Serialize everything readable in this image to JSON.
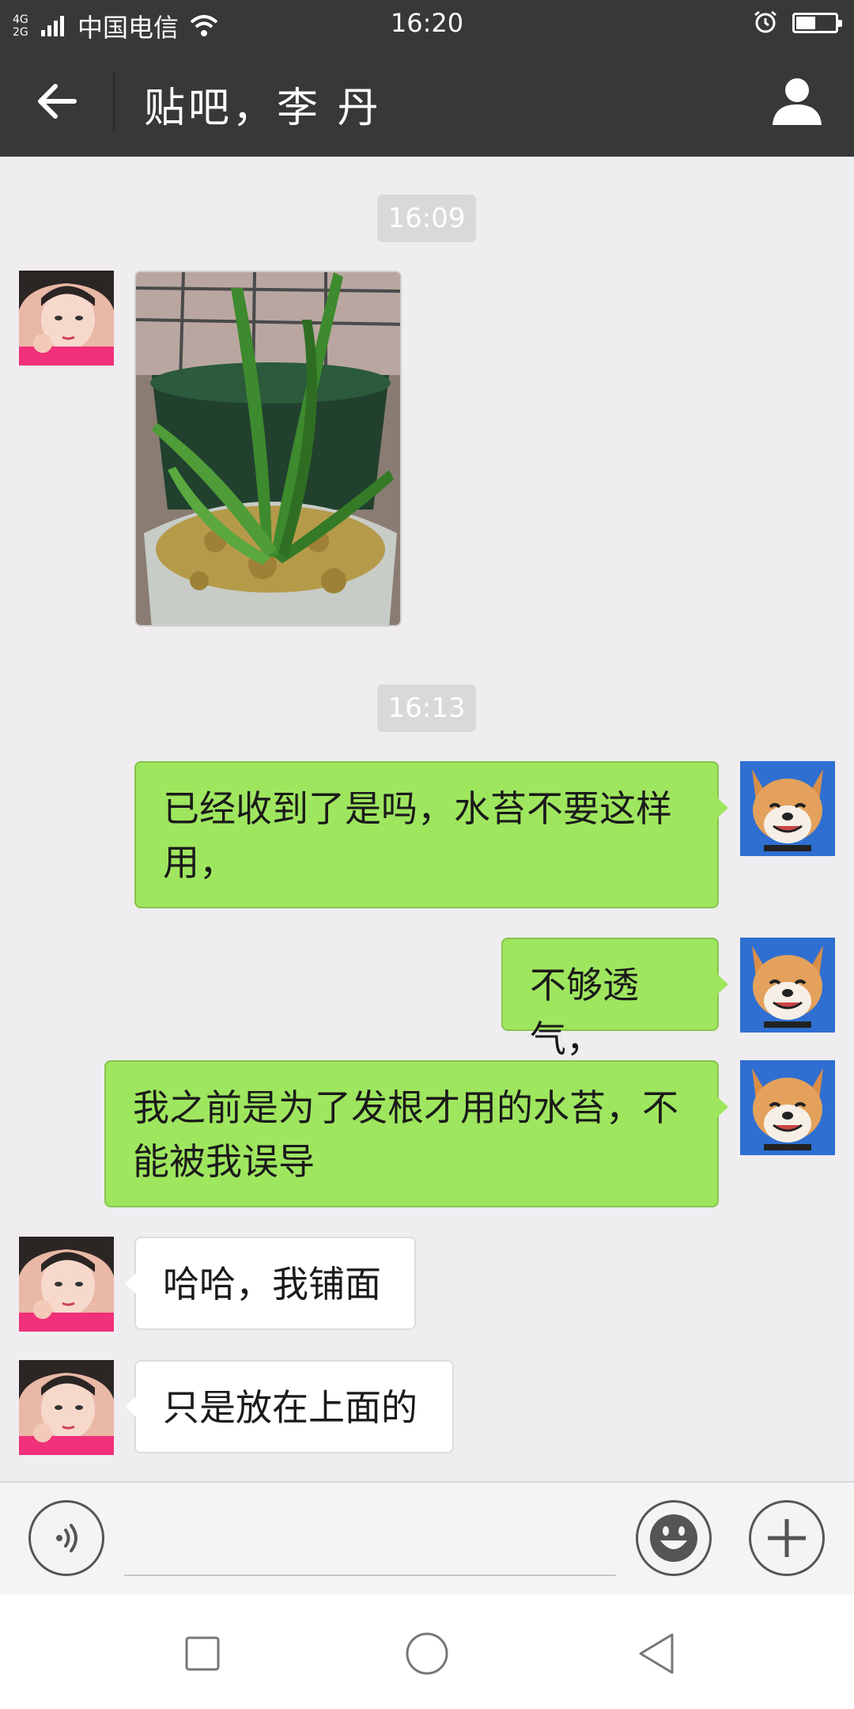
{
  "status_bar": {
    "network": "4G 2G",
    "carrier": "中国电信",
    "time": "16:20"
  },
  "header": {
    "title": "贴吧，李 丹"
  },
  "timestamps": [
    "16:09",
    "16:13"
  ],
  "messages": [
    {
      "sender": "contact",
      "type": "image"
    },
    {
      "sender": "me",
      "type": "text",
      "text": "已经收到了是吗，水苔不要这样用，"
    },
    {
      "sender": "me",
      "type": "text",
      "text": "不够透气，"
    },
    {
      "sender": "me",
      "type": "text",
      "text": "我之前是为了发根才用的水苔，不能被我误导"
    },
    {
      "sender": "contact",
      "type": "text",
      "text": "哈哈，我铺面"
    },
    {
      "sender": "contact",
      "type": "text",
      "text": "只是放在上面的"
    }
  ],
  "input": {
    "value": "",
    "placeholder": ""
  },
  "icons": {
    "back": "arrow-left-icon",
    "profile": "person-icon",
    "voice": "voice-icon",
    "emoji": "emoji-icon",
    "more": "plus-icon",
    "nav_recent": "square-icon",
    "nav_home": "circle-icon",
    "nav_back": "triangle-back-icon"
  },
  "colors": {
    "header_bg": "#383838",
    "chat_bg": "#efedef",
    "outgoing_bubble": "#9fe65f",
    "incoming_bubble": "#ffffff",
    "timestamp_bg": "#d9d9d9"
  }
}
